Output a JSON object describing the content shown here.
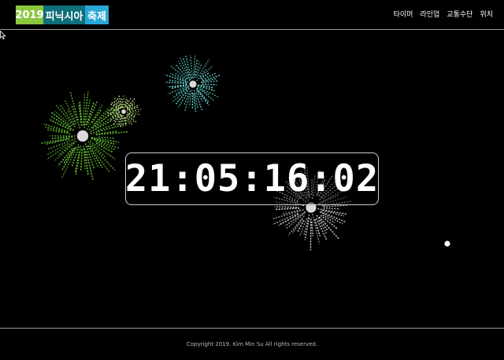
{
  "header": {
    "logo": {
      "year": "2019",
      "name": "피닉시아",
      "fest": "축제",
      "colors": {
        "year": "#8cc63f",
        "name": "#0f6f7a",
        "fest": "#29a7d6"
      }
    },
    "nav": [
      {
        "label": "타이머"
      },
      {
        "label": "라인업"
      },
      {
        "label": "교통수단"
      },
      {
        "label": "위치"
      }
    ]
  },
  "main": {
    "clock": "21:05:16:02",
    "fireworks": [
      {
        "name": "green-firework",
        "color": "#6fd13a"
      },
      {
        "name": "light-green-firework",
        "color": "#c8f08a"
      },
      {
        "name": "cyan-firework",
        "color": "#6fe3d8"
      },
      {
        "name": "white-firework",
        "color": "#e8e8e8"
      }
    ]
  },
  "footer": {
    "copyright": "Copyright 2019. Kim Min Su All rights reserved."
  }
}
